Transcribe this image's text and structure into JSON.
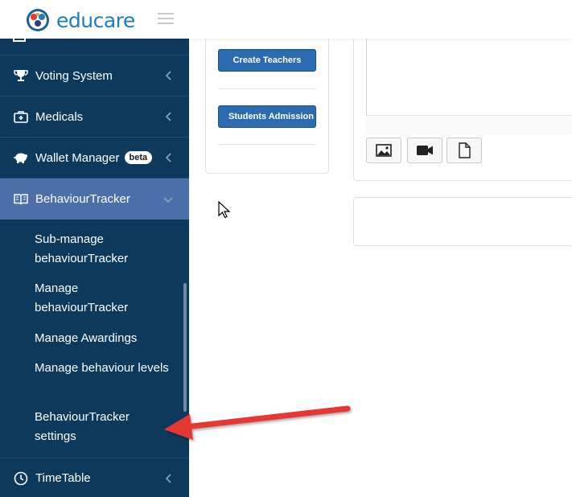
{
  "brand": {
    "name": "educare"
  },
  "sidebar": {
    "items": [
      {
        "label": "Voting System",
        "icon": "trophy-icon"
      },
      {
        "label": "Medicals",
        "icon": "medical-kit-icon"
      },
      {
        "label": "Wallet Manager",
        "icon": "piggy-bank-icon",
        "badge": "beta"
      },
      {
        "label": "BehaviourTracker",
        "icon": "book-icon",
        "active": true
      },
      {
        "label": "TimeTable",
        "icon": "clock-icon"
      }
    ],
    "submenu": [
      {
        "label": "Sub-manage behaviourTracker"
      },
      {
        "label": "Manage behaviourTracker"
      },
      {
        "label": "Manage Awardings"
      },
      {
        "label": "Manage behaviour levels"
      },
      {
        "label": "BehaviourTracker settings"
      }
    ]
  },
  "main": {
    "quick_actions": [
      {
        "label": "Create Teachers"
      },
      {
        "label": "Students Admission"
      }
    ],
    "attach_tools": [
      "image-icon",
      "video-icon",
      "file-icon"
    ]
  },
  "colors": {
    "sidebar_bg": "#0d3a5c",
    "active_item_bg": "#4b6fa8",
    "button_blue": "#2b6bb0",
    "brand_blue": "#1e7fb8",
    "arrow_red": "#e53935"
  }
}
